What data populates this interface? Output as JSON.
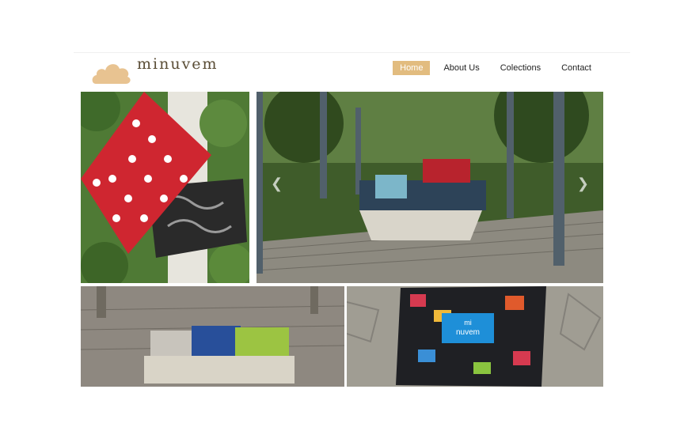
{
  "site": {
    "brand": "minuvem",
    "logo_icon": "cloud-icon",
    "accent_color": "#e2bc7f"
  },
  "nav": {
    "items": [
      {
        "label": "Home",
        "active": true
      },
      {
        "label": "About Us",
        "active": false
      },
      {
        "label": "Colections",
        "active": false
      },
      {
        "label": "Contact",
        "active": false
      }
    ]
  },
  "product_label": {
    "line1": "mi",
    "line2": "nuvem"
  },
  "carousel": {
    "prev_icon": "chevron-left-icon",
    "next_icon": "chevron-right-icon"
  }
}
